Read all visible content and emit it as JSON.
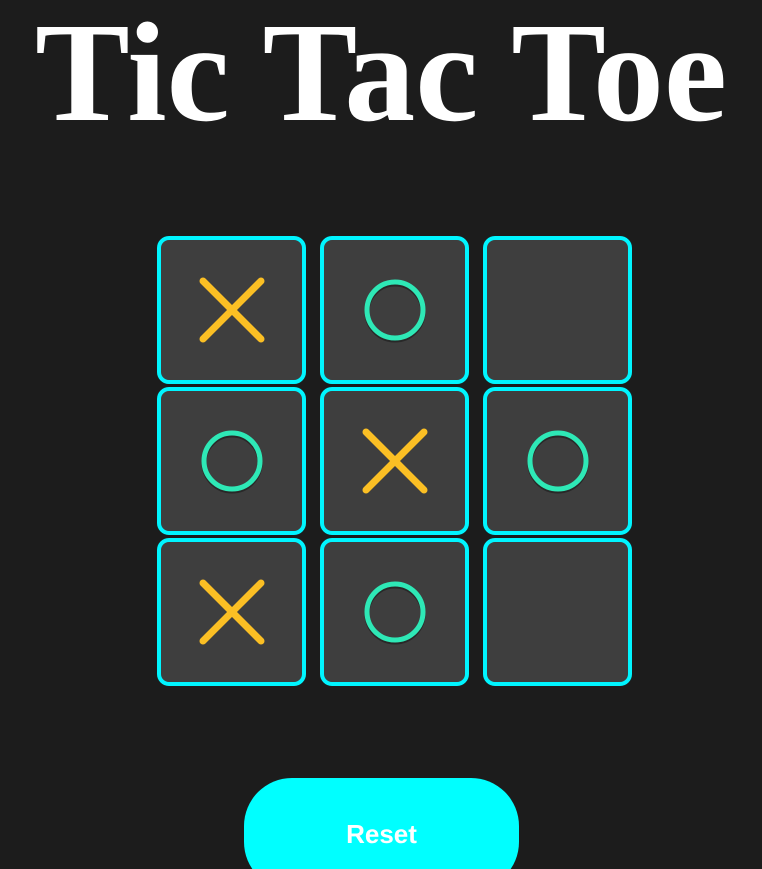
{
  "title": "Tic Tac Toe",
  "board": {
    "cells": [
      "X",
      "O",
      "",
      "O",
      "X",
      "O",
      "X",
      "O",
      ""
    ]
  },
  "reset_label": "Reset",
  "colors": {
    "background": "#1c1c1c",
    "cell_fill": "#3e3e3e",
    "cell_border": "#00f5ff",
    "x_mark": "#fbbf24",
    "o_mark": "#2ee8b6",
    "reset_button": "#00ffff",
    "title_text": "#ffffff"
  },
  "icons": {
    "X": "x-mark-icon",
    "O": "o-mark-icon"
  }
}
